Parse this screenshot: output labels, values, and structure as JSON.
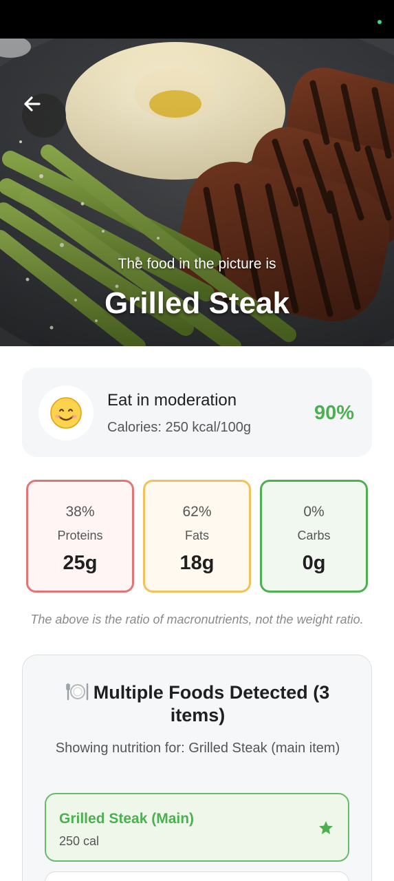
{
  "hero": {
    "subtitle": "The food in the picture is",
    "title": "Grilled Steak"
  },
  "verdict": {
    "emoji": "😊",
    "title": "Eat in moderation",
    "calories": "Calories: 250 kcal/100g",
    "score": "90%",
    "score_color": "#4caf50"
  },
  "macros": [
    {
      "percent": "38%",
      "label": "Proteins",
      "amount": "25g",
      "color": "#e57373"
    },
    {
      "percent": "62%",
      "label": "Fats",
      "amount": "18g",
      "color": "#f5c05a"
    },
    {
      "percent": "0%",
      "label": "Carbs",
      "amount": "0g",
      "color": "#4caf50"
    }
  ],
  "note": "The above is the ratio of macronutrients, not the weight ratio.",
  "multi": {
    "title": "Multiple Foods Detected (3 items)",
    "subtitle": "Showing nutrition for: Grilled Steak (main item)",
    "items": [
      {
        "name": "Grilled Steak (Main)",
        "calories": "250 cal",
        "icon": "star-icon"
      }
    ]
  }
}
